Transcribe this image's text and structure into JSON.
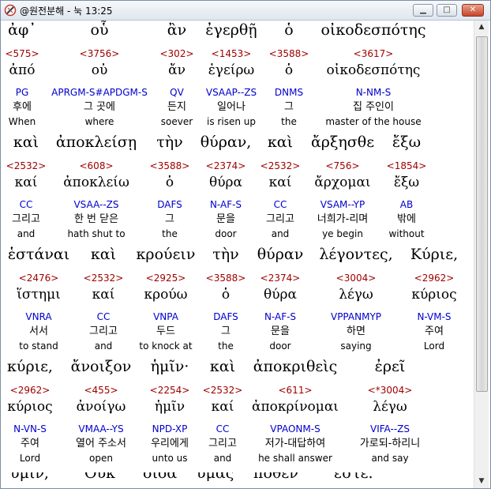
{
  "window": {
    "title": "@원전분해 - 눅 13:25",
    "minimize": "▁",
    "maximize": "□",
    "close": "✕"
  },
  "rows": [
    {
      "words": [
        {
          "greek": "ἀφ᾽",
          "num": "<575>",
          "lemma": "ἀπό",
          "parse": "PG",
          "kor": "후에",
          "eng": "When"
        },
        {
          "greek": "οὗ",
          "num": "<3756>",
          "lemma": "οὐ",
          "parse": "APRGM-S#APDGM-S",
          "kor": "그 곳에",
          "eng": "where"
        },
        {
          "greek": "ἂν",
          "num": "<302>",
          "lemma": "ἄν",
          "parse": "QV",
          "kor": "든지",
          "eng": "soever"
        },
        {
          "greek": "ἐγερθῇ",
          "num": "<1453>",
          "lemma": "ἐγείρω",
          "parse": "VSAAP--ZS",
          "kor": "일어나",
          "eng": "is risen up"
        },
        {
          "greek": "ὁ",
          "num": "<3588>",
          "lemma": "ὁ",
          "parse": "DNMS",
          "kor": "그",
          "eng": "the"
        },
        {
          "greek": "οἰκοδεσπότης",
          "num": "<3617>",
          "lemma": "οἰκοδεσπότης",
          "parse": "N-NM-S",
          "kor": "집 주인이",
          "eng": "master of the house"
        }
      ]
    },
    {
      "words": [
        {
          "greek": "καὶ",
          "num": "<2532>",
          "lemma": "καί",
          "parse": "CC",
          "kor": "그리고",
          "eng": "and"
        },
        {
          "greek": "ἀποκλείσῃ",
          "num": "<608>",
          "lemma": "ἀποκλείω",
          "parse": "VSAA--ZS",
          "kor": "한 번 닫은",
          "eng": "hath shut to"
        },
        {
          "greek": "τὴν",
          "num": "<3588>",
          "lemma": "ὁ",
          "parse": "DAFS",
          "kor": "그",
          "eng": "the"
        },
        {
          "greek": "θύραν,",
          "num": "<2374>",
          "lemma": "θύρα",
          "parse": "N-AF-S",
          "kor": "문을",
          "eng": "door"
        },
        {
          "greek": "καὶ",
          "num": "<2532>",
          "lemma": "καί",
          "parse": "CC",
          "kor": "그리고",
          "eng": "and"
        },
        {
          "greek": "ἄρξησθε",
          "num": "<756>",
          "lemma": "ἄρχομαι",
          "parse": "VSAM--YP",
          "kor": "너희가-리며",
          "eng": "ye begin"
        },
        {
          "greek": "ἔξω",
          "num": "<1854>",
          "lemma": "ἔξω",
          "parse": "AB",
          "kor": "밖에",
          "eng": "without"
        }
      ]
    },
    {
      "words": [
        {
          "greek": "ἑστάναι",
          "num": "<2476>",
          "lemma": "ἵστημι",
          "parse": "VNRA",
          "kor": "서서",
          "eng": "to stand"
        },
        {
          "greek": "καὶ",
          "num": "<2532>",
          "lemma": "καί",
          "parse": "CC",
          "kor": "그리고",
          "eng": "and"
        },
        {
          "greek": "κρούειν",
          "num": "<2925>",
          "lemma": "κρούω",
          "parse": "VNPA",
          "kor": "두드",
          "eng": "to knock at"
        },
        {
          "greek": "τὴν",
          "num": "<3588>",
          "lemma": "ὁ",
          "parse": "DAFS",
          "kor": "그",
          "eng": "the"
        },
        {
          "greek": "θύραν",
          "num": "<2374>",
          "lemma": "θύρα",
          "parse": "N-AF-S",
          "kor": "문을",
          "eng": "door"
        },
        {
          "greek": "λέγοντες,",
          "num": "<3004>",
          "lemma": "λέγω",
          "parse": "VPPANMYP",
          "kor": "하면",
          "eng": "saying"
        },
        {
          "greek": "Κύριε,",
          "num": "<2962>",
          "lemma": "κύριος",
          "parse": "N-VM-S",
          "kor": "주여",
          "eng": "Lord"
        }
      ]
    },
    {
      "words": [
        {
          "greek": "κύριε,",
          "num": "<2962>",
          "lemma": "κύριος",
          "parse": "N-VN-S",
          "kor": "주여",
          "eng": "Lord"
        },
        {
          "greek": "ἄνοιξον",
          "num": "<455>",
          "lemma": "ἀνοίγω",
          "parse": "VMAA--YS",
          "kor": "열어 주소서",
          "eng": "open"
        },
        {
          "greek": "ἡμῖν·",
          "num": "<2254>",
          "lemma": "ἡμῖν",
          "parse": "NPD-XP",
          "kor": "우리에게",
          "eng": "unto us"
        },
        {
          "greek": "καὶ",
          "num": "<2532>",
          "lemma": "καί",
          "parse": "CC",
          "kor": "그리고",
          "eng": "and"
        },
        {
          "greek": "ἀποκριθεὶς",
          "num": "<611>",
          "lemma": "ἀποκρίνομαι",
          "parse": "VPAONM-S",
          "kor": "저가-대답하여",
          "eng": "he shall answer"
        },
        {
          "greek": "ἐρεῖ",
          "num": "<*3004>",
          "lemma": "λέγω",
          "parse": "VIFA--ZS",
          "kor": "가로되-하리니",
          "eng": "and say"
        }
      ]
    }
  ],
  "cutoff": [
    "ὑμῖν,",
    "Οὐκ",
    "οἶδα",
    "ὑμᾶς",
    "πόθεν",
    "ἐστέ."
  ]
}
